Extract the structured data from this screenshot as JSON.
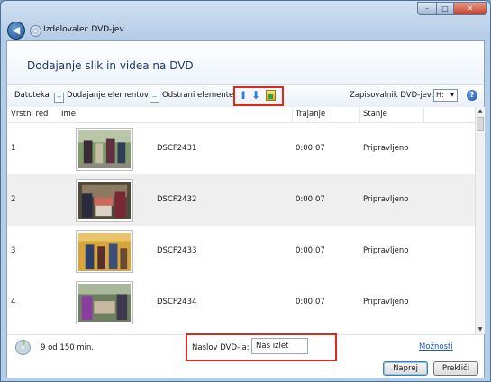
{
  "window": {
    "title": "Izdelovalec DVD-jev",
    "caption_min": "–",
    "caption_max": "□",
    "caption_close": "✕"
  },
  "page": {
    "heading": "Dodajanje slik in videa na DVD"
  },
  "toolbar": {
    "file_label": "Datoteka",
    "add_label": "Dodajanje elementov",
    "remove_label": "Odstrani elemente",
    "move_up_icon": "arrow-up-icon",
    "move_down_icon": "arrow-down-icon",
    "add_picture_icon": "picture-add-icon",
    "burner_label": "Zapisovalnik DVD-jev:",
    "burner_value": "H:",
    "help_glyph": "?"
  },
  "columns": {
    "order": "Vrstni red",
    "name": "Ime",
    "duration": "Trajanje",
    "status": "Stanje"
  },
  "items": [
    {
      "order": "1",
      "name": "DSCF2431",
      "duration": "0:00:07",
      "status": "Pripravljeno"
    },
    {
      "order": "2",
      "name": "DSCF2432",
      "duration": "0:00:07",
      "status": "Pripravljeno"
    },
    {
      "order": "3",
      "name": "DSCF2433",
      "duration": "0:00:07",
      "status": "Pripravljeno"
    },
    {
      "order": "4",
      "name": "DSCF2434",
      "duration": "0:00:07",
      "status": "Pripravljeno"
    }
  ],
  "footer": {
    "usage_text": "9 od 150 min.",
    "usage_fraction": 0.06,
    "dvd_title_label": "Naslov DVD-ja:",
    "dvd_title_value": "Naš izlet",
    "options_link": "Možnosti",
    "next_button": "Naprej",
    "cancel_button": "Prekliči"
  },
  "colors": {
    "highlight_box": "#e0281c",
    "accent_blue": "#2a7fd8",
    "selected_row": "#efefef"
  }
}
